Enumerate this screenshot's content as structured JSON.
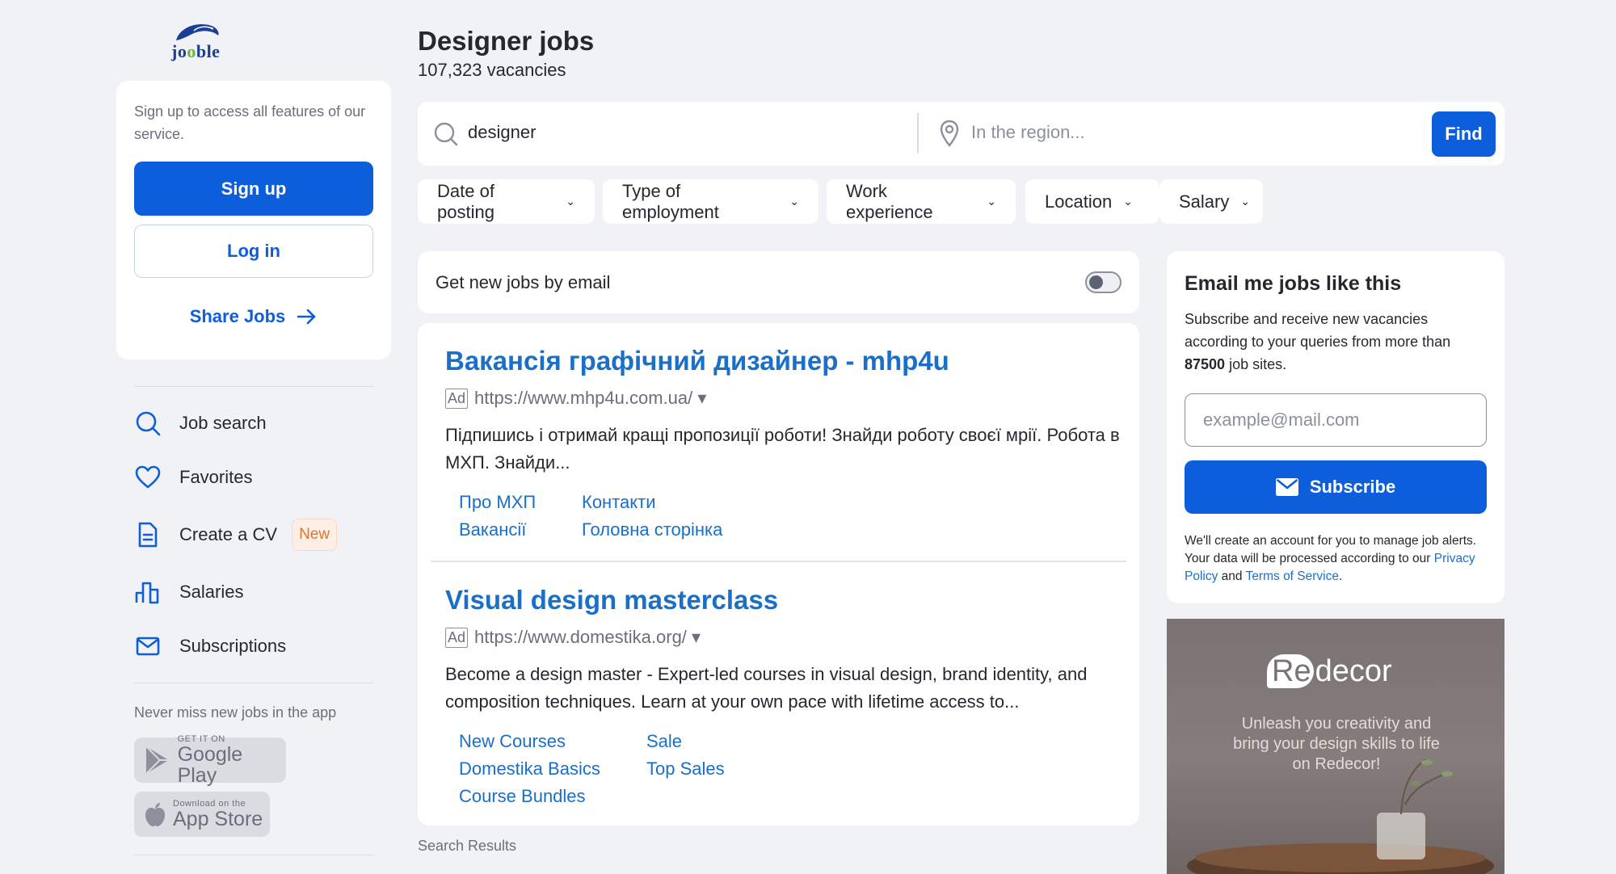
{
  "logo": {
    "alt": "jooble"
  },
  "sidebar": {
    "signup_text": "Sign up to access all features of our service.",
    "signup_label": "Sign up",
    "login_label": "Log in",
    "share_label": "Share Jobs",
    "nav": [
      {
        "label": "Job search",
        "icon": "search-icon"
      },
      {
        "label": "Favorites",
        "icon": "heart-icon"
      },
      {
        "label": "Create a CV",
        "icon": "document-icon",
        "badge": "New"
      },
      {
        "label": "Salaries",
        "icon": "bar-chart-icon"
      },
      {
        "label": "Subscriptions",
        "icon": "mail-icon"
      }
    ],
    "app_title": "Never miss new jobs in the app",
    "google_play": {
      "small": "GET IT ON",
      "big": "Google Play"
    },
    "app_store": {
      "small": "Download on the",
      "big": "App Store"
    }
  },
  "header": {
    "title": "Designer jobs",
    "count": "107,323 vacancies"
  },
  "search": {
    "query": "designer",
    "region_placeholder": "In the region...",
    "find_label": "Find"
  },
  "filters": [
    {
      "label": "Date of posting"
    },
    {
      "label": "Type of employment"
    },
    {
      "label": "Work experience"
    },
    {
      "label": "Location"
    },
    {
      "label": "Salary"
    }
  ],
  "email_toggle": {
    "label": "Get new jobs by email",
    "on": false
  },
  "ads": [
    {
      "title": "Вакансія графічний дизайнер - mhp4u",
      "tag": "Ad",
      "url": "https://www.mhp4u.com.ua/ ▾",
      "desc": "Підпишись і отримай кращі пропозиції роботи! Знайди роботу своєї мрії. Робота в МХП. Знайди...",
      "links": [
        "Про МХП",
        "Контакти",
        "Вакансії",
        "Головна сторінка"
      ]
    },
    {
      "title": "Visual design masterclass",
      "tag": "Ad",
      "url": "https://www.domestika.org/ ▾",
      "desc": "Become a design master - Expert-led courses in visual design, brand identity, and composition techniques. Learn at your own pace with lifetime access to...",
      "links": [
        "New Courses",
        "Sale",
        "Domestika Basics",
        "Top Sales",
        "Course Bundles"
      ]
    }
  ],
  "search_results_label": "Search Results",
  "subscribe": {
    "title": "Email me jobs like this",
    "desc_before": "Subscribe and receive new vacancies according to your queries from more than ",
    "desc_bold": "87500",
    "desc_after": " job sites.",
    "email_placeholder": "example@mail.com",
    "button_label": "Subscribe",
    "legal_before": "We'll create an account for you to manage job alerts. Your data will be processed according to our ",
    "privacy_label": "Privacy Policy",
    "legal_and": " and ",
    "terms_label": "Terms of Service",
    "legal_end": "."
  },
  "banner": {
    "brand_re": "Re",
    "brand_rest": "decor",
    "tagline": "Unleash you creativity and bring your design skills to life on Redecor!"
  },
  "colors": {
    "primary": "#0d5edb",
    "link": "#1a6fc9",
    "background": "#f1f2f6",
    "badge_bg": "#fdeee6",
    "badge_text": "#e0762e"
  }
}
